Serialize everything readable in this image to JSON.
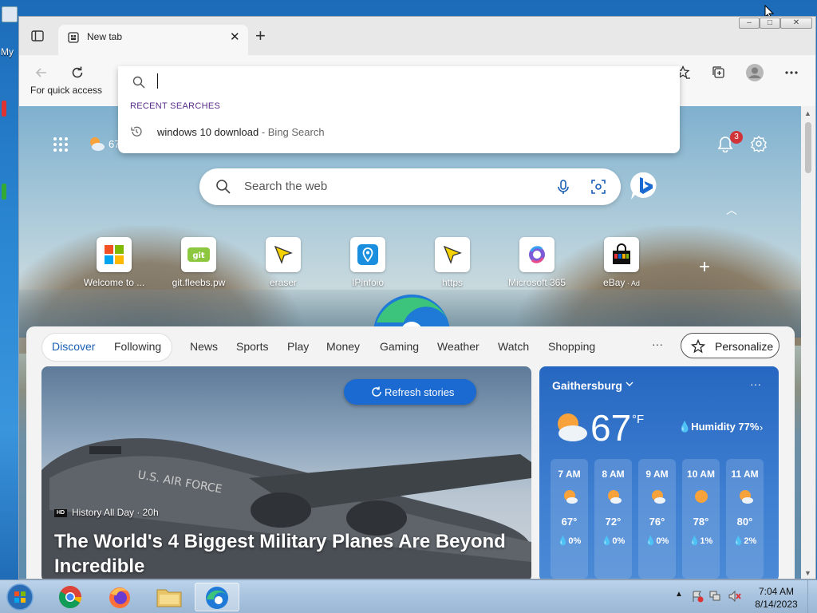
{
  "desktop": {
    "icon_label": "My"
  },
  "browser": {
    "tab": {
      "title": "New tab"
    },
    "favorites_bar": {
      "text": "For quick access"
    },
    "omnibox": {
      "section_header": "RECENT SEARCHES",
      "recent": [
        {
          "query": "windows 10 download",
          "source": " - Bing Search"
        }
      ]
    }
  },
  "newtab": {
    "weather_mini": {
      "temp": "67°F"
    },
    "notifications_count": "3",
    "search_placeholder": "Search the web",
    "quick_links": [
      {
        "label": "Welcome to ...",
        "icon": "windows-logo-icon"
      },
      {
        "label": "git.fleebs.pw",
        "icon": "git-icon"
      },
      {
        "label": "eraser",
        "icon": "eraser-icon"
      },
      {
        "label": "IPinfoio",
        "icon": "ipinfo-icon"
      },
      {
        "label": "https",
        "icon": "cursor-icon"
      },
      {
        "label": "Microsoft 365",
        "icon": "m365-icon"
      },
      {
        "label": "eBay",
        "sub": "Ad",
        "icon": "ebay-icon"
      }
    ],
    "feed": {
      "tabs": [
        "Discover",
        "Following",
        "News",
        "Sports",
        "Play",
        "Money",
        "Gaming",
        "Weather",
        "Watch",
        "Shopping"
      ],
      "more": "···",
      "personalize": "Personalize",
      "refresh": "Refresh stories",
      "story": {
        "source_logo": "HD",
        "source": "History All Day · 20h",
        "title": "The World's 4 Biggest Military Planes Are Beyond Incredible",
        "plane_text": "U.S. AIR FORCE"
      },
      "weather": {
        "city": "Gaithersburg",
        "more": "···",
        "temp": "67",
        "unit": "°F",
        "humidity": "Humidity 77%",
        "hourly": [
          {
            "time": "7 AM",
            "temp": "67°",
            "precip": "0%"
          },
          {
            "time": "8 AM",
            "temp": "72°",
            "precip": "0%"
          },
          {
            "time": "9 AM",
            "temp": "76°",
            "precip": "0%"
          },
          {
            "time": "10 AM",
            "temp": "78°",
            "precip": "1%"
          },
          {
            "time": "11 AM",
            "temp": "80°",
            "precip": "2%"
          }
        ]
      }
    }
  },
  "taskbar": {
    "apps": [
      "chrome",
      "firefox",
      "file-explorer",
      "edge"
    ],
    "time": "7:04 AM",
    "date": "8/14/2023"
  },
  "colors": {
    "accent": "#1a6ad1",
    "weather_card": "#2667c1",
    "taskbar": "#a8c3df"
  }
}
